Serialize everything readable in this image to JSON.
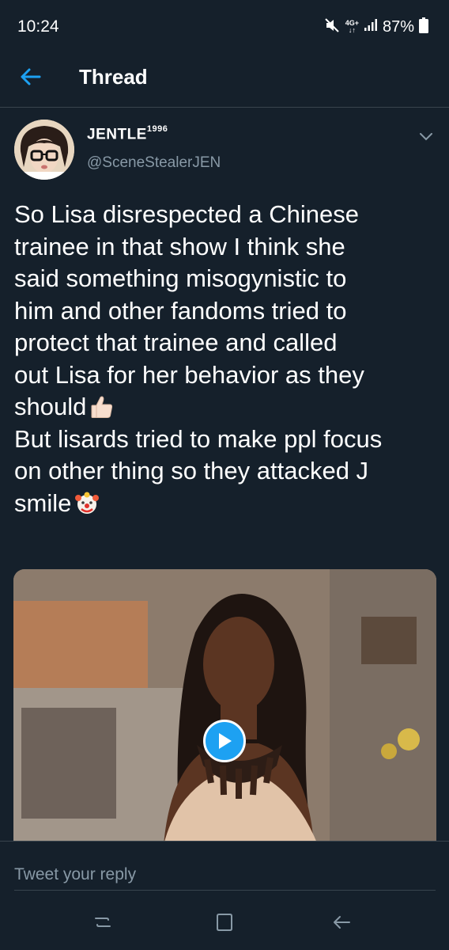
{
  "status_bar": {
    "time": "10:24",
    "network": "4G+",
    "battery": "87%"
  },
  "header": {
    "title": "Thread",
    "back_icon": "arrow-left-icon"
  },
  "tweet": {
    "author": {
      "name": "JENTLE",
      "name_superscript": "1996",
      "handle": "@SceneStealerJEN"
    },
    "text_lines": [
      "So Lisa disrespected a Chinese",
      "trainee in that show I think she",
      "said something misogynistic to",
      "him and other fandoms tried to",
      "protect that trainee and called",
      "out Lisa for her behavior as they",
      "should",
      "But lisards tried to make ppl focus",
      "on other thing so they attacked J",
      "smile"
    ],
    "emojis": [
      "thumbs-up-emoji",
      "clown-emoji"
    ],
    "media": {
      "type": "video",
      "play_icon": "play-icon"
    }
  },
  "reply": {
    "placeholder": "Tweet your reply"
  },
  "nav_bar": {
    "items": [
      "recents-icon",
      "home-icon",
      "back-icon"
    ]
  },
  "colors": {
    "background": "#15202b",
    "accent": "#1da1f2",
    "secondary_text": "#8899a6",
    "divider": "#38444d"
  }
}
